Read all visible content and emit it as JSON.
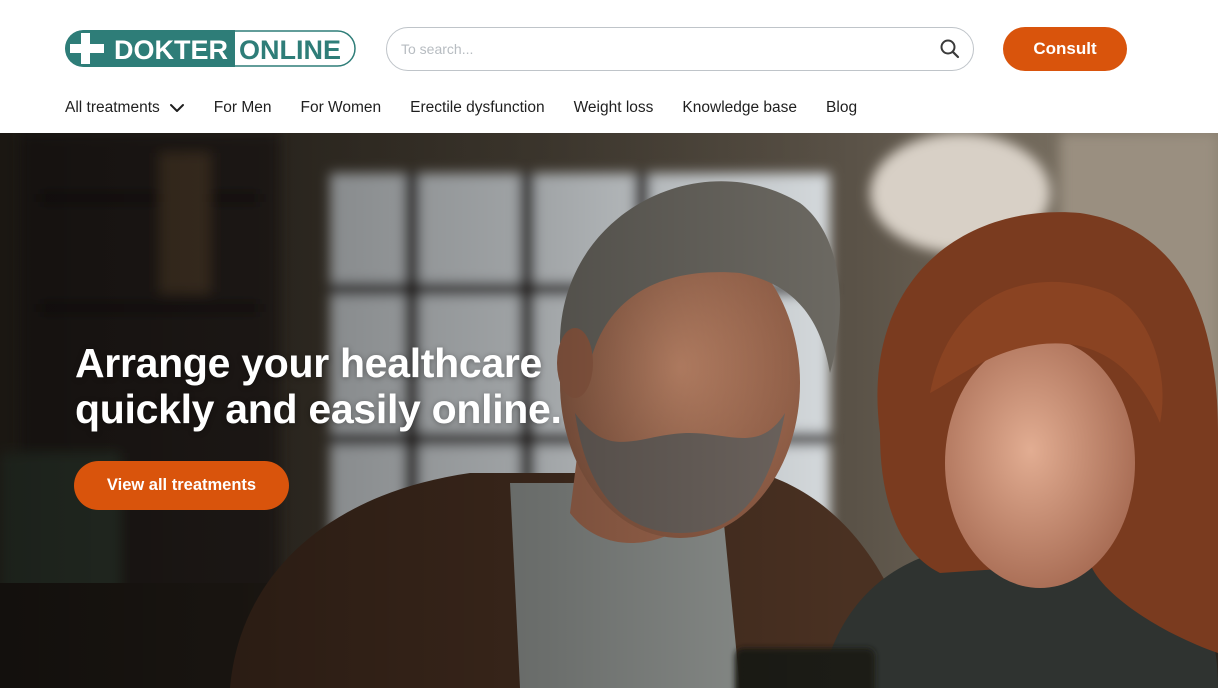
{
  "brand": {
    "logo_word_1": "DOKTER",
    "logo_word_2": "ONLINE",
    "primary_color": "#2e7d78",
    "accent_color": "#d9540c"
  },
  "search": {
    "placeholder": "To search...",
    "value": "",
    "icon": "search-icon"
  },
  "header": {
    "consult_label": "Consult"
  },
  "nav": {
    "items": [
      {
        "label": "All treatments",
        "icon": "chevron-down-icon"
      },
      {
        "label": "For Men"
      },
      {
        "label": "For Women"
      },
      {
        "label": "Erectile dysfunction"
      },
      {
        "label": "Weight loss"
      },
      {
        "label": "Knowledge base"
      },
      {
        "label": "Blog"
      }
    ]
  },
  "hero": {
    "title_line_1": "Arrange your healthcare",
    "title_line_2": "quickly and easily online.",
    "cta_label": "View all treatments"
  }
}
